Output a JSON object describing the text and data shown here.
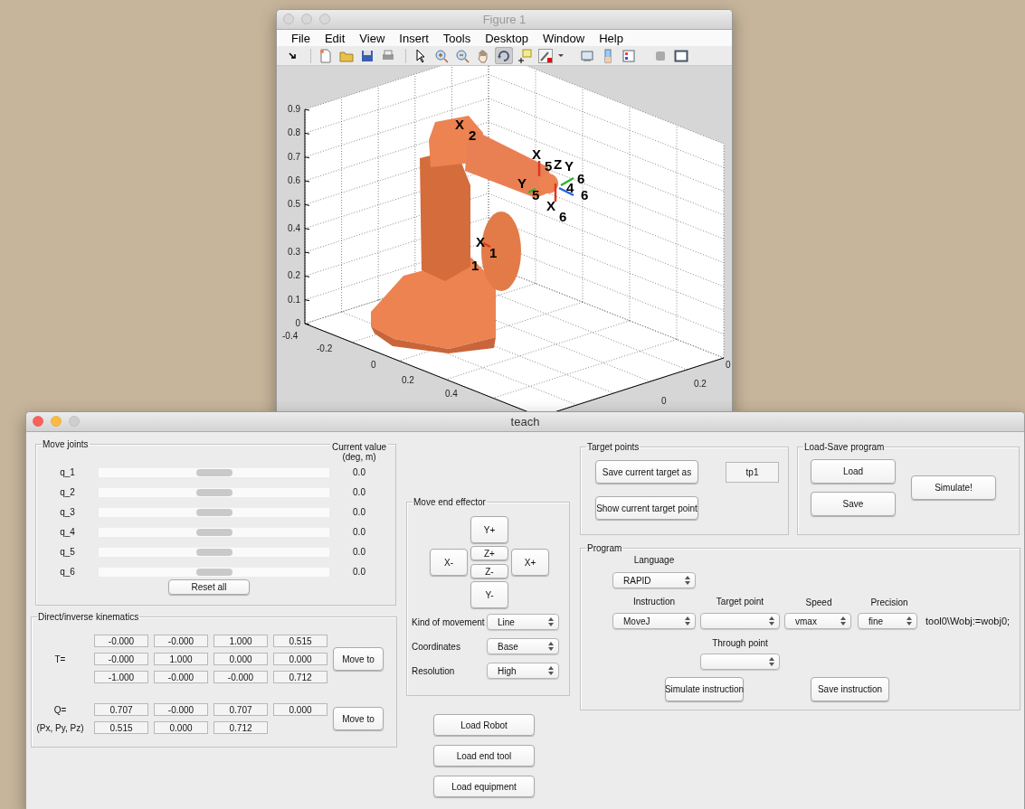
{
  "figure_window": {
    "title": "Figure 1",
    "active": false,
    "menu": [
      "File",
      "Edit",
      "View",
      "Insert",
      "Tools",
      "Desktop",
      "Window",
      "Help"
    ],
    "toolbar": [
      {
        "kind": "arrow",
        "selected": false
      },
      {
        "kind": "new",
        "selected": false
      },
      {
        "kind": "open",
        "selected": false
      },
      {
        "kind": "save",
        "selected": false
      },
      {
        "kind": "print",
        "selected": false
      },
      {
        "kind": "pointer",
        "selected": false
      },
      {
        "kind": "zoom-in",
        "selected": false
      },
      {
        "kind": "zoom-out",
        "selected": false
      },
      {
        "kind": "pan",
        "selected": false
      },
      {
        "kind": "rotate",
        "selected": true
      },
      {
        "kind": "datacursor",
        "selected": false
      },
      {
        "kind": "brush",
        "selected": false
      },
      {
        "kind": "dropdown",
        "selected": false
      },
      {
        "kind": "link",
        "selected": false
      },
      {
        "kind": "colorbar",
        "selected": false
      },
      {
        "kind": "legend",
        "selected": false
      },
      {
        "kind": "hide",
        "selected": false
      },
      {
        "kind": "show",
        "selected": false
      }
    ],
    "plot": {
      "z_ticks": [
        "0.9",
        "0.8",
        "0.7",
        "0.6",
        "0.5",
        "0.4",
        "0.3",
        "0.2",
        "0.1",
        "0"
      ],
      "x_ticks": [
        "-0.4",
        "-0.2",
        "0",
        "0.2",
        "0.4"
      ],
      "y_ticks": [
        "0",
        "0.2",
        "0"
      ],
      "frame_labels": [
        "X",
        "2",
        "X",
        "5",
        "Z",
        "Y",
        "Y",
        "5",
        "6",
        "4",
        "6",
        "X",
        "6",
        "X",
        "1",
        "1"
      ]
    }
  },
  "teach_window": {
    "title": "teach",
    "active": true,
    "move_joints": {
      "title": "Move joints",
      "value_header": "Current value (deg, m)",
      "joints": [
        {
          "label": "q_1",
          "level": 0.5,
          "value": "0.0"
        },
        {
          "label": "q_2",
          "level": 0.5,
          "value": "0.0"
        },
        {
          "label": "q_3",
          "level": 0.5,
          "value": "0.0"
        },
        {
          "label": "q_4",
          "level": 0.5,
          "value": "0.0"
        },
        {
          "label": "q_5",
          "level": 0.5,
          "value": "0.0"
        },
        {
          "label": "q_6",
          "level": 0.5,
          "value": "0.0"
        }
      ],
      "reset_button": "Reset all"
    },
    "kinematics": {
      "title": "Direct/inverse kinematics",
      "t_label": "T=",
      "t_matrix": [
        [
          "-0.000",
          "-0.000",
          "1.000",
          "0.515"
        ],
        [
          "-0.000",
          "1.000",
          "0.000",
          "0.000"
        ],
        [
          "-1.000",
          "-0.000",
          "-0.000",
          "0.712"
        ]
      ],
      "move_to_button": "Move to",
      "q_label": "Q=",
      "q_values": [
        "0.707",
        "-0.000",
        "0.707",
        "0.000"
      ],
      "p_label": "(Px, Py, Pz)",
      "p_values": [
        "0.515",
        "0.000",
        "0.712"
      ],
      "move_to_button_2": "Move to"
    },
    "move_end_effector": {
      "title": "Move end effector",
      "jog_buttons": {
        "y_plus": "Y+",
        "x_minus": "X-",
        "z_plus": "Z+",
        "z_minus": "Z-",
        "x_plus": "X+",
        "y_minus": "Y-"
      },
      "settings": [
        {
          "label": "Kind of movement",
          "value": "Line"
        },
        {
          "label": "Coordinates",
          "value": "Base"
        },
        {
          "label": "Resolution",
          "value": "High"
        }
      ]
    },
    "load_buttons": [
      "Load Robot",
      "Load end tool",
      "Load equipment"
    ],
    "target_points": {
      "title": "Target points",
      "save_button": "Save current target as",
      "name_field": "tp1",
      "show_button": "Show current target point"
    },
    "load_save_program": {
      "title": "Load-Save program",
      "load_button": "Load",
      "save_button": "Save",
      "simulate_button": "Simulate!"
    },
    "program": {
      "title": "Program",
      "language_label": "Language",
      "language": "RAPID",
      "instruction_label": "Instruction",
      "instruction": "MoveJ",
      "target_point_label": "Target point",
      "speed_label": "Speed",
      "speed": "vmax",
      "precision_label": "Precision",
      "precision": "fine",
      "suffix": "tool0\\Wobj:=wobj0;",
      "through_point_label": "Through point",
      "simulate_instruction_button": "Simulate instruction",
      "save_instruction_button": "Save instruction"
    }
  }
}
